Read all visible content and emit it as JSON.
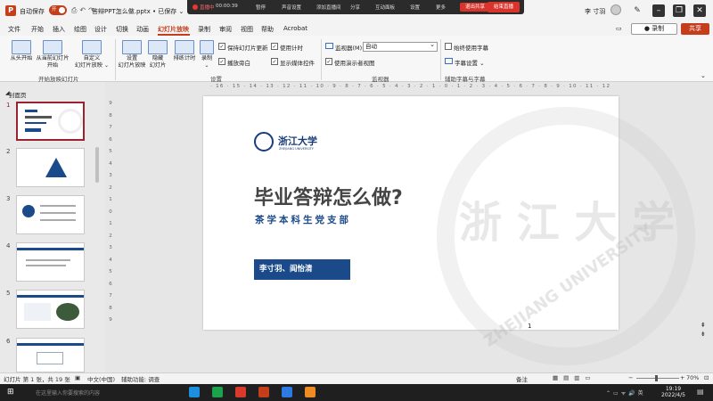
{
  "titlebar": {
    "autosave_label": "自动保存",
    "autosave_state": "开",
    "doc_title": "答辩PPT怎么做.pptx • 已保存 ⌄",
    "user": "李 寸羽"
  },
  "recording_bar": {
    "status": "直播中",
    "time": "00:00:39",
    "items": [
      "暂停",
      "声音设置",
      "添加直播间",
      "分享",
      "互动面板",
      "设置",
      "更多"
    ],
    "end_button": "退出共享",
    "start_button": "结束直播"
  },
  "menu": {
    "tabs": [
      "文件",
      "开始",
      "插入",
      "绘图",
      "设计",
      "切换",
      "动画",
      "幻灯片放映",
      "录制",
      "审阅",
      "视图",
      "帮助",
      "Acrobat"
    ],
    "active_tab": "幻灯片放映",
    "record_label": "● 录制",
    "share_label": "共享"
  },
  "ribbon": {
    "start_group": {
      "buttons": [
        "从头开始",
        "从当前幻灯片\n开始",
        "自定义\n幻灯片放映 ⌄"
      ],
      "label": "开始放映幻灯片"
    },
    "setup_group": {
      "buttons": [
        "设置\n幻灯片放映",
        "隐藏\n幻灯片",
        "排练计时",
        "录制\n⌄"
      ],
      "label": "设置"
    },
    "checkboxes": [
      {
        "label": "保持幻灯片更新",
        "checked": true
      },
      {
        "label": "使用计时",
        "checked": true
      },
      {
        "label": "播放旁白",
        "checked": true
      },
      {
        "label": "显示媒体控件",
        "checked": true
      }
    ],
    "monitor": {
      "label": "监视器(M):",
      "value": "自动",
      "presenter_view": "使用演示者视图",
      "group_label": "监视器"
    },
    "captions": {
      "always_use": "始终使用字幕",
      "settings": "字幕设置 ⌄",
      "group_label": "辅助字幕与字幕"
    }
  },
  "slides_panel": {
    "section": "封面页",
    "thumbnails": [
      {
        "num": "1",
        "selected": true
      },
      {
        "num": "2",
        "selected": false
      },
      {
        "num": "3",
        "selected": false
      },
      {
        "num": "4",
        "selected": false
      },
      {
        "num": "5",
        "selected": false
      },
      {
        "num": "6",
        "selected": false
      }
    ]
  },
  "rulers": {
    "top": "· 16 · 15 · 14 · 13 · 12 · 11 · 10 · 9 · 8 · 7 · 6 · 5 · 4 · 3 · 2 · 1 · 0 · 1 · 2 · 3 · 4 · 5 · 6 · 7 · 8 · 9 · 10 · 11 · 12 · 13 · 14 · 15 · 16 ·",
    "left": [
      "9",
      "8",
      "7",
      "6",
      "5",
      "4",
      "3",
      "2",
      "1",
      "0",
      "1",
      "2",
      "3",
      "4",
      "5",
      "6",
      "7",
      "8",
      "9"
    ]
  },
  "slide": {
    "logo_text": "浙江大学",
    "logo_sub": "ZHEJIANG UNIVERSITY",
    "title": "毕业答辩怎么做?",
    "subtitle": "茶学本科生党支部",
    "names": "李寸羽、阎怡清",
    "watermark": "浙 江 大 学",
    "page_number": "1"
  },
  "statusbar": {
    "slide_info": "幻灯片 第 1 张，共 19 张",
    "language": "中文(中国)",
    "accessibility": "辅助功能: 调查",
    "notes": "备注",
    "zoom": "70%"
  },
  "taskbar": {
    "search_text": "在这里输入你要搜索的内容",
    "time": "19:19",
    "date": "2022/4/5"
  }
}
